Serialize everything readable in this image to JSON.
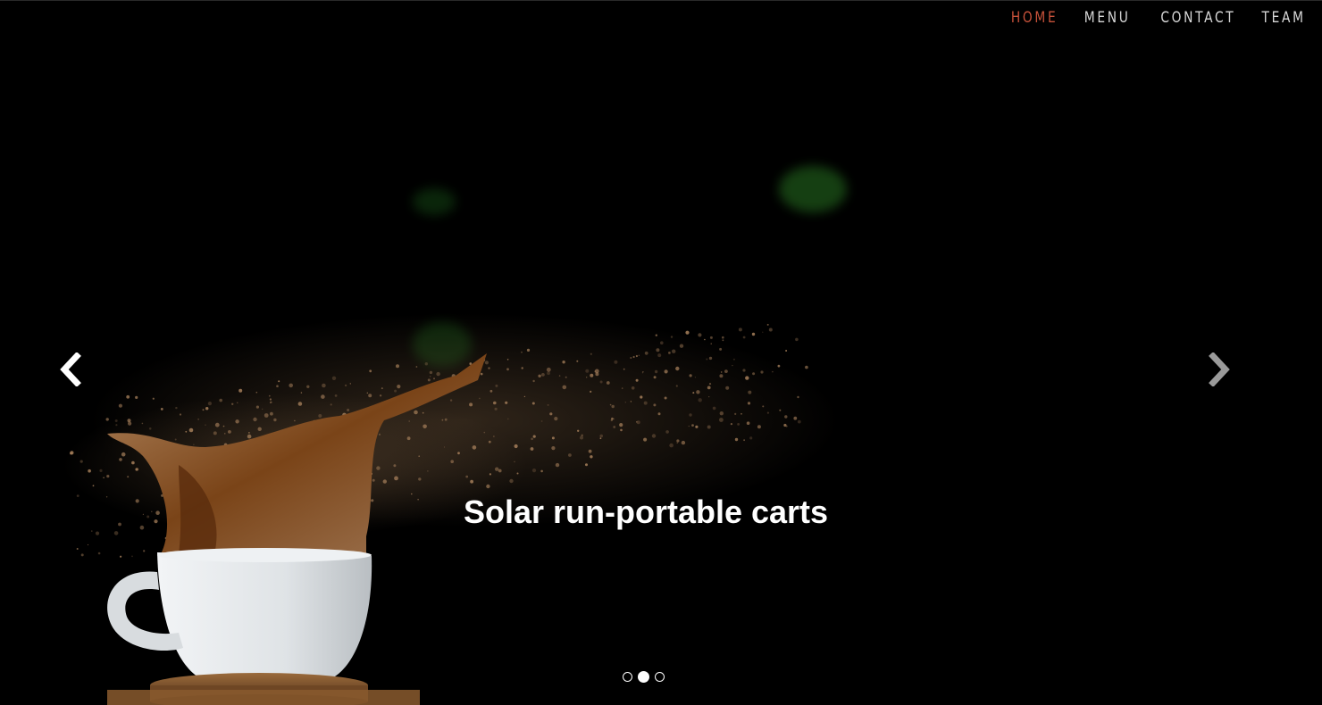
{
  "nav": {
    "items": [
      {
        "label": "HOME",
        "active": true
      },
      {
        "label": "MENU",
        "active": false
      },
      {
        "label": "CONTACT",
        "active": false
      },
      {
        "label": "TEAM",
        "active": false
      }
    ],
    "active_color": "#c8523a",
    "color": "#d8d8d8"
  },
  "carousel": {
    "caption": "Solar run-portable carts",
    "slide_count": 3,
    "active_index": 1,
    "prev_icon": "chevron-left-icon",
    "next_icon": "chevron-right-icon"
  },
  "colors": {
    "background": "#000000",
    "coffee": "#8a5a32",
    "cup": "#dfe3e6"
  }
}
